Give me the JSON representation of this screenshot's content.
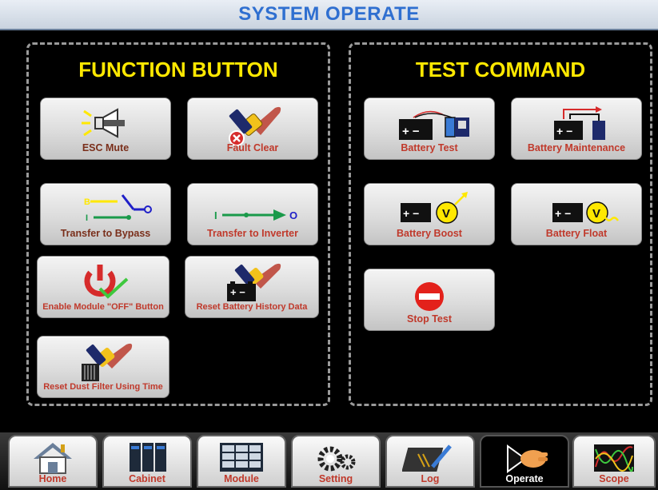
{
  "title": "SYSTEM OPERATE",
  "function_panel": {
    "title": "FUNCTION BUTTON",
    "buttons": [
      {
        "label": "ESC Mute",
        "icon": "speaker-mute-icon"
      },
      {
        "label": "Fault Clear",
        "icon": "fault-clear-icon"
      },
      {
        "label": "Transfer to Bypass",
        "icon": "transfer-bypass-icon",
        "icon_text_b": "B",
        "icon_text_i": "I"
      },
      {
        "label": "Transfer to Inverter",
        "icon": "transfer-inverter-icon",
        "icon_text_i": "I",
        "icon_text_o": "O"
      },
      {
        "label": "Enable Module \"OFF\" Button",
        "icon": "power-check-icon"
      },
      {
        "label": "Reset Battery History Data",
        "icon": "battery-reset-icon"
      },
      {
        "label": "Reset Dust Filter Using Time",
        "icon": "dust-filter-reset-icon"
      }
    ]
  },
  "test_panel": {
    "title": "TEST COMMAND",
    "buttons": [
      {
        "label": "Battery Test",
        "icon": "battery-test-icon"
      },
      {
        "label": "Battery Maintenance",
        "icon": "battery-maintenance-icon"
      },
      {
        "label": "Battery Boost",
        "icon": "battery-boost-icon",
        "icon_text_v": "V"
      },
      {
        "label": "Battery Float",
        "icon": "battery-float-icon",
        "icon_text_v": "V"
      },
      {
        "label": "Stop Test",
        "icon": "stop-icon"
      }
    ]
  },
  "nav": {
    "active": "Operate",
    "tabs": [
      {
        "label": "Home",
        "icon": "home-icon"
      },
      {
        "label": "Cabinet",
        "icon": "cabinet-icon"
      },
      {
        "label": "Module",
        "icon": "module-icon"
      },
      {
        "label": "Setting",
        "icon": "gears-icon"
      },
      {
        "label": "Log",
        "icon": "log-icon"
      },
      {
        "label": "Operate",
        "icon": "operate-hand-icon"
      },
      {
        "label": "Scope",
        "icon": "scope-waveform-icon"
      }
    ]
  },
  "colors": {
    "title_text": "#2f6fd0",
    "panel_title": "#ffe800",
    "button_label": "#c0392b",
    "active_tab_label": "#ffffff"
  }
}
